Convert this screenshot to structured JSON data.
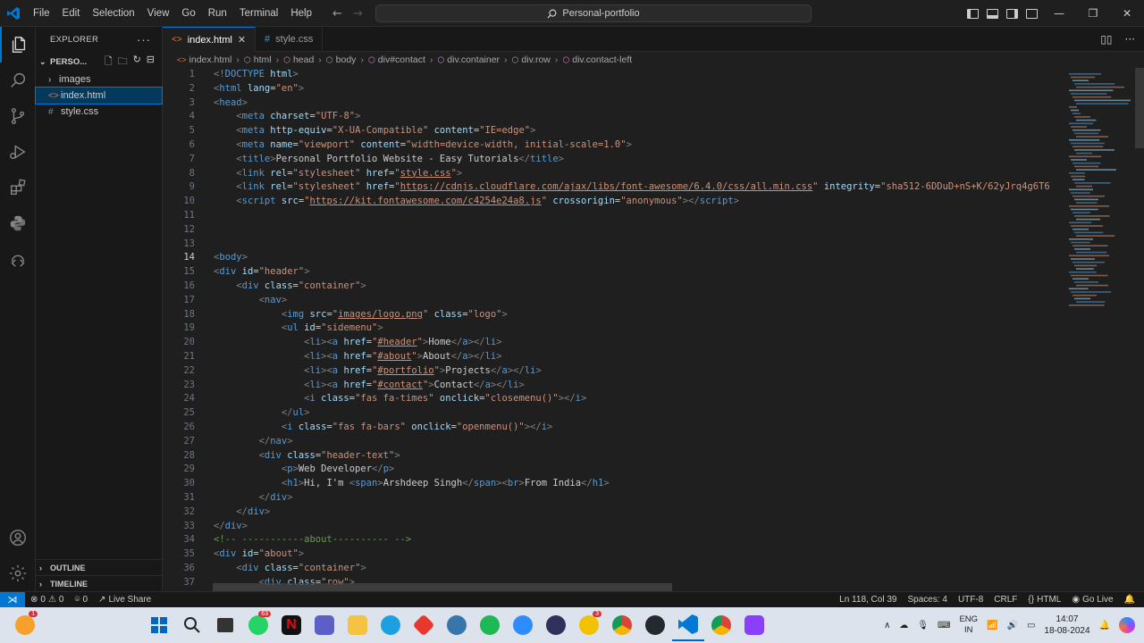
{
  "titlebar": {
    "menu": [
      "File",
      "Edit",
      "Selection",
      "View",
      "Go",
      "Run",
      "Terminal",
      "Help"
    ],
    "search": "Personal-portfolio"
  },
  "sidebar": {
    "title": "EXPLORER",
    "folder": "PERSO...",
    "items": [
      {
        "label": "images",
        "type": "folder"
      },
      {
        "label": "index.html",
        "type": "html",
        "selected": true
      },
      {
        "label": "style.css",
        "type": "css"
      }
    ],
    "outline": "OUTLINE",
    "timeline": "TIMELINE"
  },
  "tabs": [
    {
      "label": "index.html",
      "icon": "html-file-icon",
      "active": true
    },
    {
      "label": "style.css",
      "icon": "css-file-icon",
      "active": false
    }
  ],
  "breadcrumb": [
    "index.html",
    "html",
    "head",
    "body",
    "div#contact",
    "div.container",
    "div.row",
    "div.contact-left"
  ],
  "code": {
    "current_line": 14,
    "lines": [
      {
        "n": "1",
        "html": "<span class='tg'>&lt;!</span><span class='tn'>DOCTYPE</span> <span class='at'>html</span><span class='tg'>&gt;</span>"
      },
      {
        "n": "2",
        "html": "<span class='tg'>&lt;</span><span class='tn'>html</span> <span class='at'>lang</span>=<span class='av'>\"en\"</span><span class='tg'>&gt;</span>"
      },
      {
        "n": "3",
        "html": "<span class='tg'>&lt;</span><span class='tn'>head</span><span class='tg'>&gt;</span>"
      },
      {
        "n": "4",
        "html": "    <span class='tg'>&lt;</span><span class='tn'>meta</span> <span class='at'>charset</span>=<span class='av'>\"UTF-8\"</span><span class='tg'>&gt;</span>"
      },
      {
        "n": "5",
        "html": "    <span class='tg'>&lt;</span><span class='tn'>meta</span> <span class='at'>http-equiv</span>=<span class='av'>\"X-UA-Compatible\"</span> <span class='at'>content</span>=<span class='av'>\"IE=edge\"</span><span class='tg'>&gt;</span>"
      },
      {
        "n": "6",
        "html": "    <span class='tg'>&lt;</span><span class='tn'>meta</span> <span class='at'>name</span>=<span class='av'>\"viewport\"</span> <span class='at'>content</span>=<span class='av'>\"width=device-width, initial-scale=1.0\"</span><span class='tg'>&gt;</span>"
      },
      {
        "n": "7",
        "html": "    <span class='tg'>&lt;</span><span class='tn'>title</span><span class='tg'>&gt;</span><span class='tx'>Personal Portfolio Website - Easy Tutorials</span><span class='tg'>&lt;/</span><span class='tn'>title</span><span class='tg'>&gt;</span>"
      },
      {
        "n": "8",
        "html": "    <span class='tg'>&lt;</span><span class='tn'>link</span> <span class='at'>rel</span>=<span class='av'>\"stylesheet\"</span> <span class='at'>href</span>=<span class='av'>\"</span><span class='ul'>style.css</span><span class='av'>\"</span><span class='tg'>&gt;</span>"
      },
      {
        "n": "9",
        "html": "    <span class='tg'>&lt;</span><span class='tn'>link</span> <span class='at'>rel</span>=<span class='av'>\"stylesheet\"</span> <span class='at'>href</span>=<span class='av'>\"</span><span class='ul'>https://cdnjs.cloudflare.com/ajax/libs/font-awesome/6.4.0/css/all.min.css</span><span class='av'>\"</span> <span class='at'>integrity</span>=<span class='av'>\"sha512-6DDuD+nS+K/62yJrq4g6T6</span>"
      },
      {
        "n": "10",
        "html": "    <span class='tg'>&lt;</span><span class='tn'>script</span> <span class='at'>src</span>=<span class='av'>\"</span><span class='ul'>https://kit.fontawesome.com/c4254e24a8.js</span><span class='av'>\"</span> <span class='at'>crossorigin</span>=<span class='av'>\"anonymous\"</span><span class='tg'>&gt;&lt;/</span><span class='tn'>script</span><span class='tg'>&gt;</span>"
      },
      {
        "n": "11",
        "html": ""
      },
      {
        "n": "12",
        "html": ""
      },
      {
        "n": "13",
        "html": ""
      },
      {
        "n": "14",
        "html": "<span class='tg'>&lt;</span><span class='tn'>body</span><span class='tg'>&gt;</span>"
      },
      {
        "n": "15",
        "html": "<span class='tg'>&lt;</span><span class='tn'>div</span> <span class='at'>id</span>=<span class='av'>\"header\"</span><span class='tg'>&gt;</span>"
      },
      {
        "n": "16",
        "html": "    <span class='tg'>&lt;</span><span class='tn'>div</span> <span class='at'>class</span>=<span class='av'>\"container\"</span><span class='tg'>&gt;</span>"
      },
      {
        "n": "17",
        "html": "        <span class='tg'>&lt;</span><span class='tn'>nav</span><span class='tg'>&gt;</span>"
      },
      {
        "n": "18",
        "html": "            <span class='tg'>&lt;</span><span class='tn'>img</span> <span class='at'>src</span>=<span class='av'>\"</span><span class='ul'>images/logo.png</span><span class='av'>\"</span> <span class='at'>class</span>=<span class='av'>\"logo\"</span><span class='tg'>&gt;</span>"
      },
      {
        "n": "19",
        "html": "            <span class='tg'>&lt;</span><span class='tn'>ul</span> <span class='at'>id</span>=<span class='av'>\"sidemenu\"</span><span class='tg'>&gt;</span>"
      },
      {
        "n": "20",
        "html": "                <span class='tg'>&lt;</span><span class='tn'>li</span><span class='tg'>&gt;&lt;</span><span class='tn'>a</span> <span class='at'>href</span>=<span class='av'>\"</span><span class='ul'>#header</span><span class='av'>\"</span><span class='tg'>&gt;</span><span class='tx'>Home</span><span class='tg'>&lt;/</span><span class='tn'>a</span><span class='tg'>&gt;&lt;/</span><span class='tn'>li</span><span class='tg'>&gt;</span>"
      },
      {
        "n": "21",
        "html": "                <span class='tg'>&lt;</span><span class='tn'>li</span><span class='tg'>&gt;&lt;</span><span class='tn'>a</span> <span class='at'>href</span>=<span class='av'>\"</span><span class='ul'>#about</span><span class='av'>\"</span><span class='tg'>&gt;</span><span class='tx'>About</span><span class='tg'>&lt;/</span><span class='tn'>a</span><span class='tg'>&gt;&lt;/</span><span class='tn'>li</span><span class='tg'>&gt;</span>"
      },
      {
        "n": "22",
        "html": "                <span class='tg'>&lt;</span><span class='tn'>li</span><span class='tg'>&gt;&lt;</span><span class='tn'>a</span> <span class='at'>href</span>=<span class='av'>\"</span><span class='ul'>#portfolio</span><span class='av'>\"</span><span class='tg'>&gt;</span><span class='tx'>Projects</span><span class='tg'>&lt;/</span><span class='tn'>a</span><span class='tg'>&gt;&lt;/</span><span class='tn'>li</span><span class='tg'>&gt;</span>"
      },
      {
        "n": "23",
        "html": "                <span class='tg'>&lt;</span><span class='tn'>li</span><span class='tg'>&gt;&lt;</span><span class='tn'>a</span> <span class='at'>href</span>=<span class='av'>\"</span><span class='ul'>#contact</span><span class='av'>\"</span><span class='tg'>&gt;</span><span class='tx'>Contact</span><span class='tg'>&lt;/</span><span class='tn'>a</span><span class='tg'>&gt;&lt;/</span><span class='tn'>li</span><span class='tg'>&gt;</span>"
      },
      {
        "n": "24",
        "html": "                <span class='tg'>&lt;</span><span class='tn'>i</span> <span class='at'>class</span>=<span class='av'>\"fas fa-times\"</span> <span class='at'>onclick</span>=<span class='av'>\"closemenu()\"</span><span class='tg'>&gt;&lt;/</span><span class='tn'>i</span><span class='tg'>&gt;</span>"
      },
      {
        "n": "25",
        "html": "            <span class='tg'>&lt;/</span><span class='tn'>ul</span><span class='tg'>&gt;</span>"
      },
      {
        "n": "26",
        "html": "            <span class='tg'>&lt;</span><span class='tn'>i</span> <span class='at'>class</span>=<span class='av'>\"fas fa-bars\"</span> <span class='at'>onclick</span>=<span class='av'>\"openmenu()\"</span><span class='tg'>&gt;&lt;/</span><span class='tn'>i</span><span class='tg'>&gt;</span>"
      },
      {
        "n": "27",
        "html": "        <span class='tg'>&lt;/</span><span class='tn'>nav</span><span class='tg'>&gt;</span>"
      },
      {
        "n": "28",
        "html": "        <span class='tg'>&lt;</span><span class='tn'>div</span> <span class='at'>class</span>=<span class='av'>\"header-text\"</span><span class='tg'>&gt;</span>"
      },
      {
        "n": "29",
        "html": "            <span class='tg'>&lt;</span><span class='tn'>p</span><span class='tg'>&gt;</span><span class='tx'>Web Developer</span><span class='tg'>&lt;/</span><span class='tn'>p</span><span class='tg'>&gt;</span>"
      },
      {
        "n": "30",
        "html": "            <span class='tg'>&lt;</span><span class='tn'>h1</span><span class='tg'>&gt;</span><span class='tx'>Hi, I'm </span><span class='tg'>&lt;</span><span class='tn'>span</span><span class='tg'>&gt;</span><span class='tx'>Arshdeep Singh</span><span class='tg'>&lt;/</span><span class='tn'>span</span><span class='tg'>&gt;&lt;</span><span class='tn'>br</span><span class='tg'>&gt;</span><span class='tx'>From India</span><span class='tg'>&lt;/</span><span class='tn'>h1</span><span class='tg'>&gt;</span>"
      },
      {
        "n": "31",
        "html": "        <span class='tg'>&lt;/</span><span class='tn'>div</span><span class='tg'>&gt;</span>"
      },
      {
        "n": "32",
        "html": "    <span class='tg'>&lt;/</span><span class='tn'>div</span><span class='tg'>&gt;</span>"
      },
      {
        "n": "33",
        "html": "<span class='tg'>&lt;/</span><span class='tn'>div</span><span class='tg'>&gt;</span>"
      },
      {
        "n": "34",
        "html": "<span class='cm'>&lt;!-- -----------about---------- --&gt;</span>"
      },
      {
        "n": "35",
        "html": "<span class='tg'>&lt;</span><span class='tn'>div</span> <span class='at'>id</span>=<span class='av'>\"about\"</span><span class='tg'>&gt;</span>"
      },
      {
        "n": "36",
        "html": "    <span class='tg'>&lt;</span><span class='tn'>div</span> <span class='at'>class</span>=<span class='av'>\"container\"</span><span class='tg'>&gt;</span>"
      },
      {
        "n": "37",
        "html": "        <span class='tg'>&lt;</span><span class='tn'>div</span> <span class='at'>class</span>=<span class='av'>\"row\"</span><span class='tg'>&gt;</span>"
      }
    ]
  },
  "statusbar": {
    "errors": "0",
    "warnings": "0",
    "ports": "0",
    "live_share": "Live Share",
    "position": "Ln 118, Col 39",
    "spaces": "Spaces: 4",
    "encoding": "UTF-8",
    "eol": "CRLF",
    "language": "HTML",
    "go_live": "Go Live"
  },
  "taskbar": {
    "lang_top": "ENG",
    "lang_bottom": "IN",
    "time": "14:07",
    "date": "18-08-2024",
    "whatsapp_badge": "63",
    "badge_1": "1",
    "badge_3": "3"
  },
  "colors": {
    "accent": "#0078d4",
    "editor_bg": "#1f1f1f",
    "sidebar_bg": "#181818",
    "tag": "#569cd6",
    "attribute": "#9cdcfe",
    "string": "#ce9178",
    "comment": "#6a9955"
  }
}
